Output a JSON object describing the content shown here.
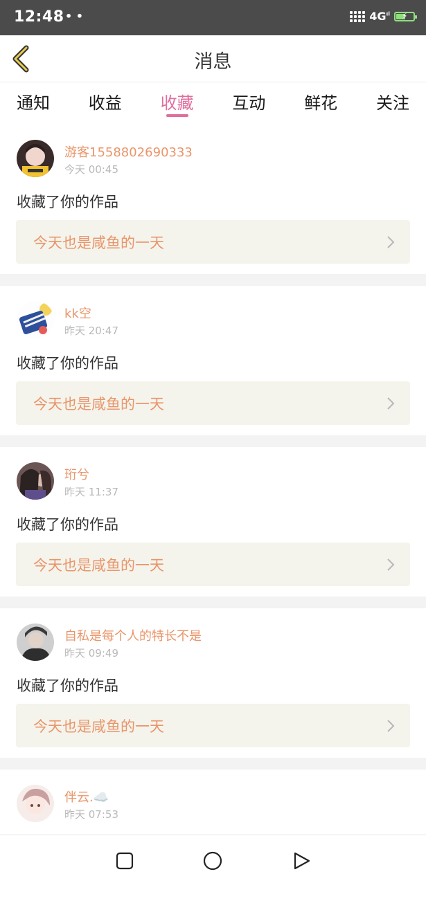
{
  "status_bar": {
    "time": "12:48",
    "dots": "• •",
    "network": "4G",
    "network_sup": "ıl",
    "battery_level": 0.55,
    "battery_color": "#8ee07d"
  },
  "header": {
    "title": "消息",
    "back_icon": "back-chevron-icon"
  },
  "tabs": [
    {
      "label": "通知",
      "active": false
    },
    {
      "label": "收益",
      "active": false
    },
    {
      "label": "收藏",
      "active": true
    },
    {
      "label": "互动",
      "active": false
    },
    {
      "label": "鲜花",
      "active": false
    },
    {
      "label": "关注",
      "active": false
    }
  ],
  "accent_color": "#df6f9e",
  "name_color": "#e9956a",
  "messages": [
    {
      "user": "游客1558802690333",
      "time": "今天 00:45",
      "action": "收藏了你的作品",
      "work_title": "今天也是咸鱼的一天"
    },
    {
      "user": "kk空",
      "time": "昨天 20:47",
      "action": "收藏了你的作品",
      "work_title": "今天也是咸鱼的一天"
    },
    {
      "user": "珩兮",
      "time": "昨天 11:37",
      "action": "收藏了你的作品",
      "work_title": "今天也是咸鱼的一天"
    },
    {
      "user": "自私是每个人的特长不是",
      "time": "昨天 09:49",
      "action": "收藏了你的作品",
      "work_title": "今天也是咸鱼的一天"
    },
    {
      "user": "伴云.☁️",
      "time": "昨天 07:53"
    }
  ],
  "nav_bar": {
    "buttons": [
      "recents-square-icon",
      "home-circle-icon",
      "back-triangle-icon"
    ]
  }
}
